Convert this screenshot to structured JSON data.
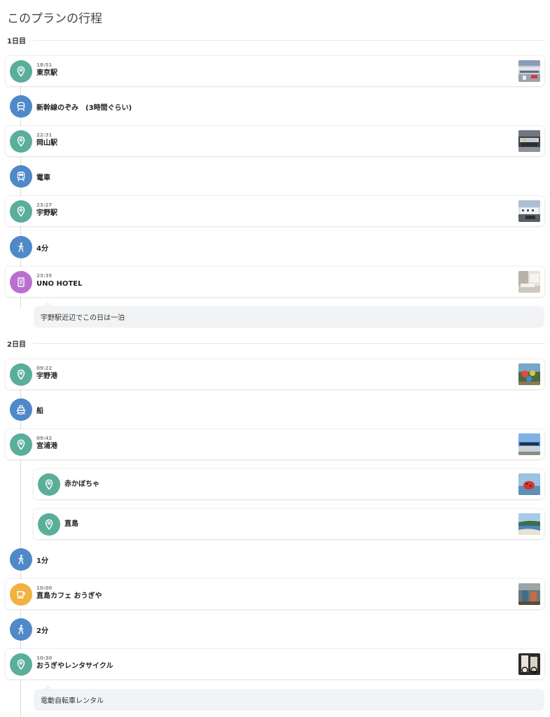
{
  "page": {
    "title": "このプランの行程"
  },
  "days": [
    {
      "label": "1日目"
    },
    {
      "label": "2日目"
    }
  ],
  "items": {
    "tokyo": {
      "time": "18:51",
      "name": "東京駅"
    },
    "shinkansen": {
      "label": "新幹線のぞみ　(3時間ぐらい)"
    },
    "okayama": {
      "time": "22:31",
      "name": "岡山駅"
    },
    "train": {
      "label": "電車"
    },
    "uno_station": {
      "time": "23:27",
      "name": "宇野駅"
    },
    "walk1": {
      "label": "4分"
    },
    "uno_hotel": {
      "time": "23:35",
      "name": "UNO HOTEL"
    },
    "note1": {
      "text": "宇野駅近辺でこの日は一泊"
    },
    "uno_port": {
      "time": "09:22",
      "name": "宇野港"
    },
    "ship": {
      "label": "船"
    },
    "miyanoura": {
      "time": "09:42",
      "name": "宮浦港"
    },
    "red_pumpkin": {
      "name": "赤かぼちゃ"
    },
    "naoshima": {
      "name": "直島"
    },
    "walk2": {
      "label": "1分"
    },
    "cafe": {
      "time": "10:00",
      "name": "直島カフェ おうぎや"
    },
    "walk3": {
      "label": "2分"
    },
    "rental": {
      "time": "10:30",
      "name": "おうぎやレンタサイクル"
    },
    "note2": {
      "text": "電動自転車レンタル"
    }
  },
  "icons": {
    "spot": "map-pin-icon",
    "shinkansen": "bullet-train-icon",
    "train": "train-icon",
    "walk": "walking-person-icon",
    "hotel": "hotel-building-icon",
    "ship": "ship-icon",
    "cafe": "coffee-cup-icon"
  },
  "colors": {
    "spot": "#5aae9a",
    "transport": "#4f89c8",
    "hotel": "#b96fd0",
    "cafe": "#f2b241"
  }
}
